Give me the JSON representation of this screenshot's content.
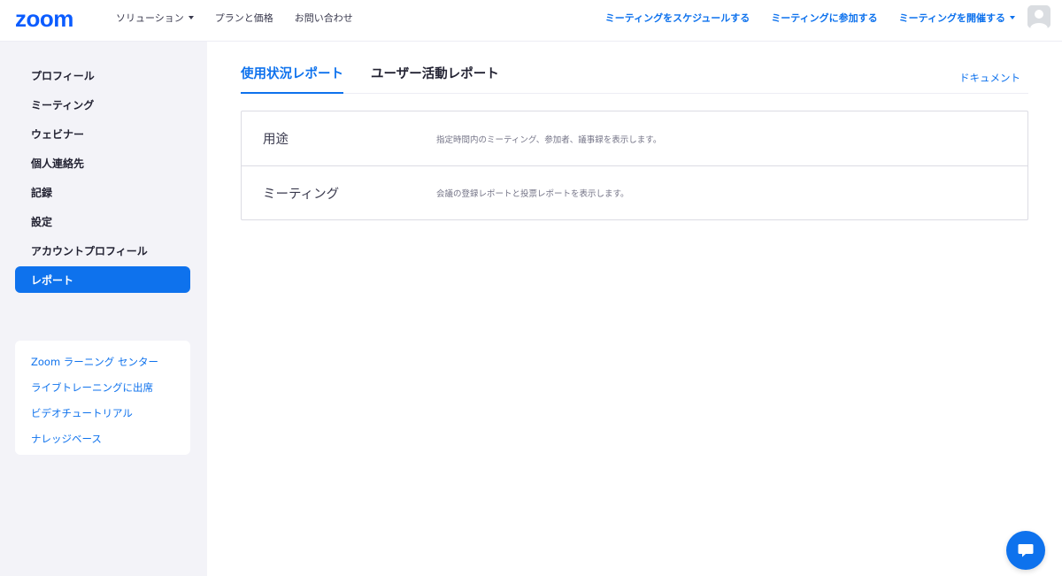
{
  "header": {
    "logo": "zoom",
    "nav_left": [
      "ソリューション",
      "プランと価格",
      "お問い合わせ"
    ],
    "nav_right": [
      "ミーティングをスケジュールする",
      "ミーティングに参加する",
      "ミーティングを開催する"
    ]
  },
  "sidebar": {
    "items": [
      {
        "label": "プロフィール"
      },
      {
        "label": "ミーティング"
      },
      {
        "label": "ウェビナー"
      },
      {
        "label": "個人連絡先"
      },
      {
        "label": "記録"
      },
      {
        "label": "設定"
      },
      {
        "label": "アカウントプロフィール"
      },
      {
        "label": "レポート",
        "active": true
      }
    ],
    "links": [
      "Zoom ラーニング センター",
      "ライブトレーニングに出席",
      "ビデオチュートリアル",
      "ナレッジベース"
    ]
  },
  "main": {
    "tabs": [
      {
        "label": "使用状況レポート",
        "active": true
      },
      {
        "label": "ユーザー活動レポート"
      }
    ],
    "doc_link": "ドキュメント",
    "reports": [
      {
        "name": "用途",
        "description": "指定時間内のミーティング、参加者、議事録を表示します。"
      },
      {
        "name": "ミーティング",
        "description": "会議の登録レポートと投票レポートを表示します。"
      }
    ]
  },
  "icons": {
    "avatar": "user-avatar-icon",
    "chat": "chat-bubble-icon",
    "dropdown": "chevron-down-icon"
  },
  "colors": {
    "accent": "#0e72ed",
    "logo": "#0b5cff",
    "sidebar_bg": "#f3f3f8"
  }
}
